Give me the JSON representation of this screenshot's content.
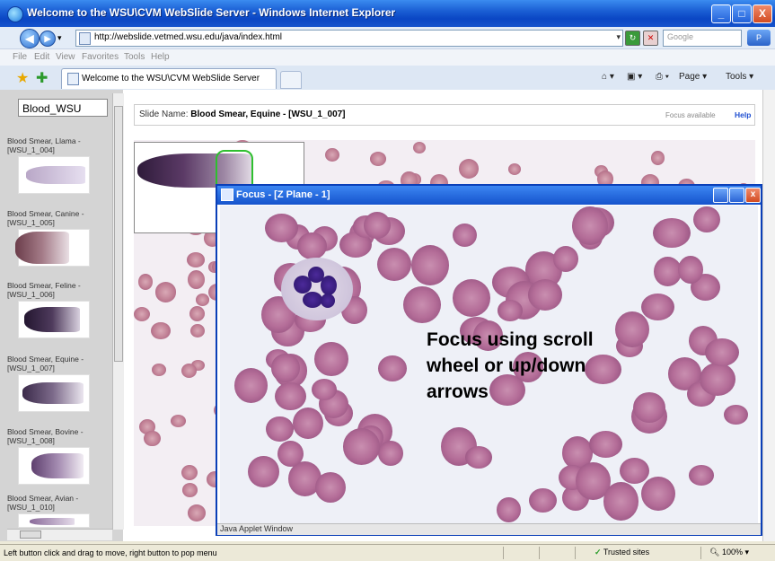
{
  "window": {
    "title": "Welcome to the WSU\\CVM WebSlide Server - Windows Internet Explorer",
    "minimize": "_",
    "maximize": "□",
    "close": "X"
  },
  "address": {
    "back": "◀",
    "forward": "▶",
    "url": "http://webslide.vetmed.wsu.edu/java/index.html",
    "search_placeholder": "Google",
    "search_go": "P"
  },
  "menu": [
    "File",
    "Edit",
    "View",
    "Favorites",
    "Tools",
    "Help"
  ],
  "tabs": {
    "active": "Welcome to the WSU\\CVM WebSlide Server",
    "page_label": "Page ▾",
    "tools_label": "Tools ▾"
  },
  "sidebar": {
    "search_value": "Blood_WSU",
    "items": [
      {
        "label": "Blood Smear, Llama - [WSU_1_004]"
      },
      {
        "label": "Blood Smear, Canine - [WSU_1_005]"
      },
      {
        "label": "Blood Smear, Feline - [WSU_1_006]"
      },
      {
        "label": "Blood Smear, Equine - [WSU_1_007]"
      },
      {
        "label": "Blood Smear, Bovine - [WSU_1_008]"
      },
      {
        "label": "Blood Smear, Avian - [WSU_1_010]"
      }
    ]
  },
  "slide": {
    "name_prefix": "Slide Name:",
    "name": "Blood Smear, Equine - [WSU_1_007]",
    "focus_available": "Focus available",
    "help": "Help"
  },
  "focus_window": {
    "title": "Focus - [Z Plane - 1]",
    "caption": "Focus using scroll\nwheel or up/down\narrows",
    "status": "Java Applet Window"
  },
  "statusbar": {
    "text": "Left button click and drag to move, right button to pop menu",
    "zone": "Trusted sites",
    "zoom": "100%"
  },
  "colors": {
    "titlebar": "#1553cc",
    "rbc": "#b46d98",
    "nucleus": "#2a1468"
  }
}
